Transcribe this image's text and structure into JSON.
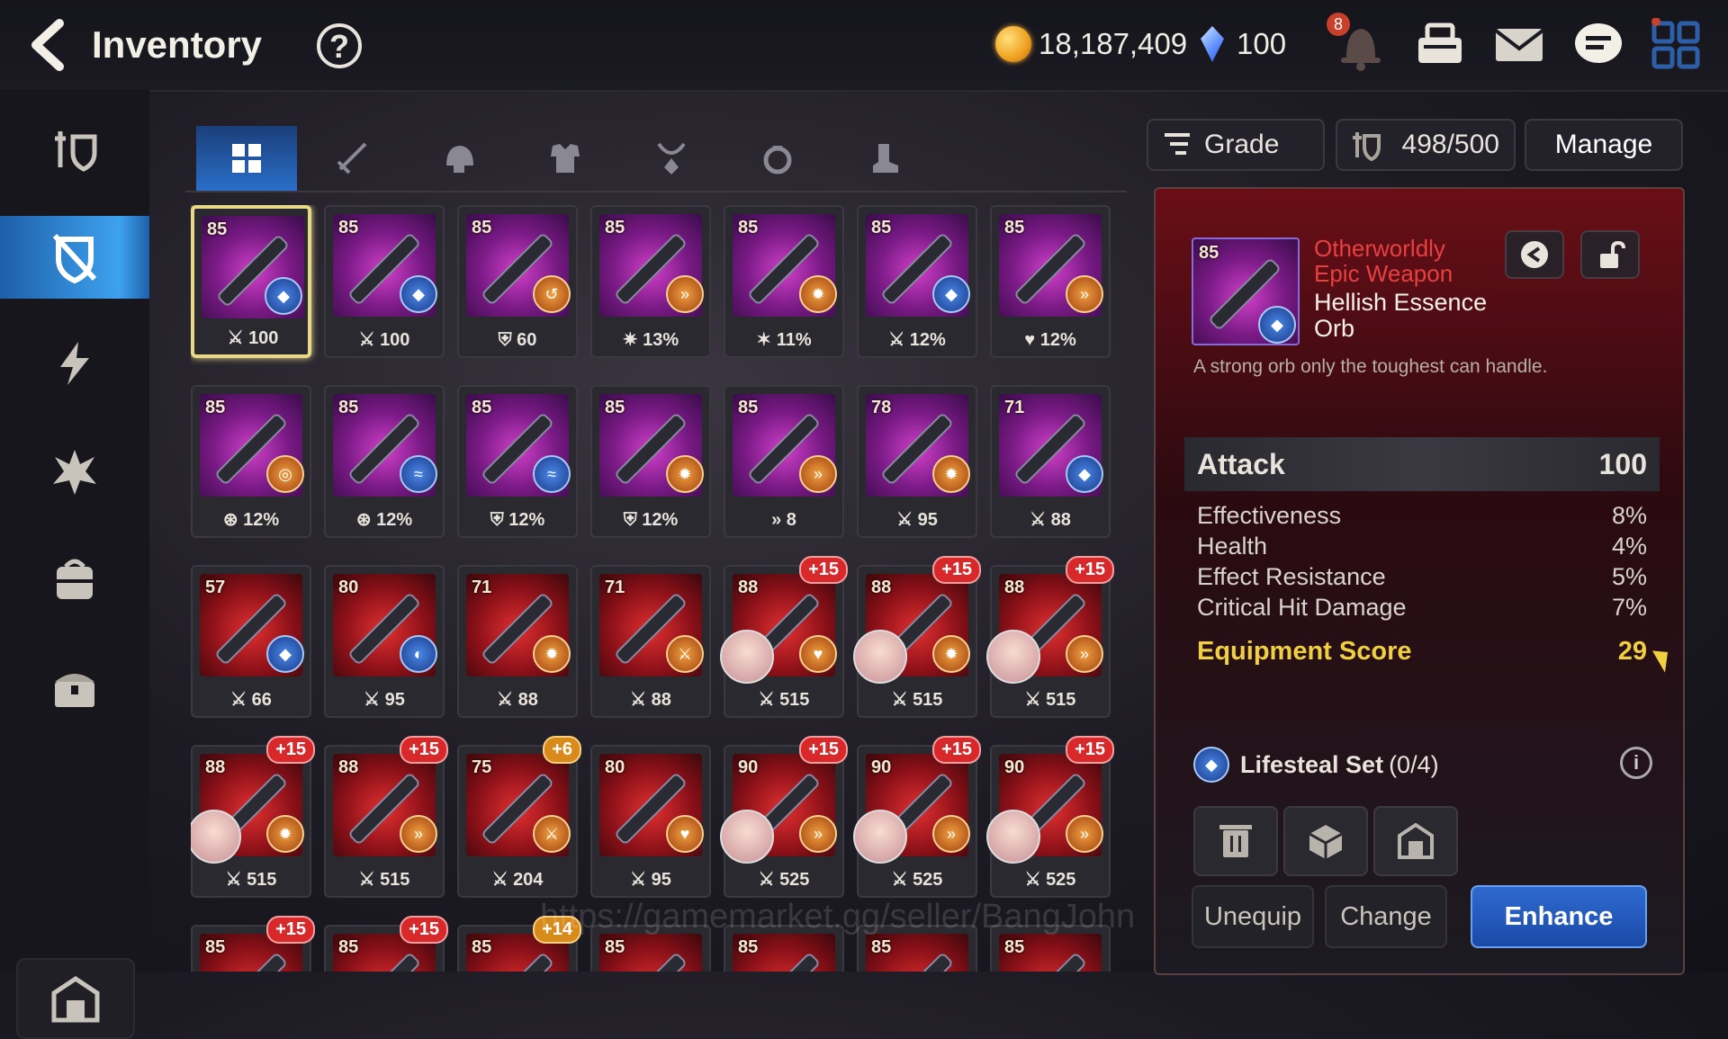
{
  "header": {
    "title": "Inventory",
    "help_label": "?",
    "gold": "18,187,409",
    "crystals": "100",
    "notification_count": "8"
  },
  "tabs": [
    "all",
    "weapon",
    "helmet",
    "armor",
    "necklace",
    "ring",
    "boots"
  ],
  "toolbar": {
    "grade_label": "Grade",
    "capacity": "498/500",
    "manage_label": "Manage"
  },
  "items": [
    {
      "level": "85",
      "stat": "100",
      "stat_icon": "attack",
      "set": "lifesteal",
      "plus": ""
    },
    {
      "level": "85",
      "stat": "100",
      "stat_icon": "attack",
      "set": "lifesteal",
      "plus": ""
    },
    {
      "level": "85",
      "stat": "60",
      "stat_icon": "defense",
      "set": "counter",
      "plus": ""
    },
    {
      "level": "85",
      "stat": "13%",
      "stat_icon": "effectiveness",
      "set": "speed",
      "plus": ""
    },
    {
      "level": "85",
      "stat": "11%",
      "stat_icon": "crit",
      "set": "immunity",
      "plus": ""
    },
    {
      "level": "85",
      "stat": "12%",
      "stat_icon": "attack",
      "set": "lifesteal",
      "plus": ""
    },
    {
      "level": "85",
      "stat": "12%",
      "stat_icon": "health",
      "set": "speed",
      "plus": ""
    },
    {
      "level": "85",
      "stat": "12%",
      "stat_icon": "resist",
      "set": "hit",
      "plus": ""
    },
    {
      "level": "85",
      "stat": "12%",
      "stat_icon": "resist",
      "set": "torrent",
      "plus": ""
    },
    {
      "level": "85",
      "stat": "12%",
      "stat_icon": "defense",
      "set": "torrent",
      "plus": ""
    },
    {
      "level": "85",
      "stat": "12%",
      "stat_icon": "defense",
      "set": "immunity",
      "plus": ""
    },
    {
      "level": "85",
      "stat": "8",
      "stat_icon": "speed",
      "set": "speed",
      "plus": ""
    },
    {
      "level": "78",
      "stat": "95",
      "stat_icon": "attack",
      "set": "immunity",
      "plus": ""
    },
    {
      "level": "71",
      "stat": "88",
      "stat_icon": "attack",
      "set": "lifesteal",
      "plus": ""
    },
    {
      "level": "57",
      "stat": "66",
      "stat_icon": "attack",
      "set": "lifesteal",
      "plus": ""
    },
    {
      "level": "80",
      "stat": "95",
      "stat_icon": "attack",
      "set": "protection",
      "plus": ""
    },
    {
      "level": "71",
      "stat": "88",
      "stat_icon": "attack",
      "set": "immunity",
      "plus": ""
    },
    {
      "level": "71",
      "stat": "88",
      "stat_icon": "attack",
      "set": "attack",
      "plus": ""
    },
    {
      "level": "88",
      "stat": "515",
      "stat_icon": "attack",
      "set": "health",
      "plus": "+15",
      "hero": true
    },
    {
      "level": "88",
      "stat": "515",
      "stat_icon": "attack",
      "set": "immunity",
      "plus": "+15",
      "hero": true
    },
    {
      "level": "88",
      "stat": "515",
      "stat_icon": "attack",
      "set": "speed",
      "plus": "+15",
      "hero": true
    },
    {
      "level": "88",
      "stat": "515",
      "stat_icon": "attack",
      "set": "immunity",
      "plus": "+15",
      "hero": true
    },
    {
      "level": "88",
      "stat": "515",
      "stat_icon": "attack",
      "set": "speed",
      "plus": "+15",
      "hero": false
    },
    {
      "level": "75",
      "stat": "204",
      "stat_icon": "attack",
      "set": "attack",
      "plus": "+6",
      "hero": false
    },
    {
      "level": "80",
      "stat": "95",
      "stat_icon": "attack",
      "set": "health",
      "plus": "",
      "hero": false
    },
    {
      "level": "90",
      "stat": "525",
      "stat_icon": "attack",
      "set": "speed",
      "plus": "+15",
      "hero": true
    },
    {
      "level": "90",
      "stat": "525",
      "stat_icon": "attack",
      "set": "speed",
      "plus": "+15",
      "hero": true
    },
    {
      "level": "90",
      "stat": "525",
      "stat_icon": "attack",
      "set": "speed",
      "plus": "+15",
      "hero": true
    },
    {
      "level": "85",
      "stat": "",
      "stat_icon": "",
      "set": "",
      "plus": "+15"
    },
    {
      "level": "85",
      "stat": "",
      "stat_icon": "",
      "set": "",
      "plus": "+15"
    },
    {
      "level": "85",
      "stat": "",
      "stat_icon": "",
      "set": "",
      "plus": "+14"
    },
    {
      "level": "85",
      "stat": "",
      "stat_icon": "",
      "set": "",
      "plus": ""
    },
    {
      "level": "85",
      "stat": "",
      "stat_icon": "",
      "set": "",
      "plus": ""
    },
    {
      "level": "85",
      "stat": "",
      "stat_icon": "",
      "set": "",
      "plus": ""
    },
    {
      "level": "85",
      "stat": "",
      "stat_icon": "",
      "set": "",
      "plus": ""
    }
  ],
  "detail": {
    "level": "85",
    "rarity_line1": "Otherworldly",
    "rarity_line2": "Epic Weapon",
    "name_line1": "Hellish Essence",
    "name_line2": "Orb",
    "description": "A strong orb only the toughest can handle.",
    "main_stat_name": "Attack",
    "main_stat_value": "100",
    "substats": [
      {
        "name": "Effectiveness",
        "value": "8%"
      },
      {
        "name": "Health",
        "value": "4%"
      },
      {
        "name": "Effect Resistance",
        "value": "5%"
      },
      {
        "name": "Critical Hit Damage",
        "value": "7%"
      }
    ],
    "score_label": "Equipment Score",
    "score_value": "29",
    "set_name": "Lifesteal Set",
    "set_count": "(0/4)",
    "unequip_label": "Unequip",
    "change_label": "Change",
    "enhance_label": "Enhance"
  },
  "watermark": "https://gamemarket.gg/seller/BangJohn",
  "colors": {
    "accent_blue": "#3ea2f0",
    "rarity_red": "#e84040",
    "score_gold": "#f0d040",
    "badge_red": "#d8282a"
  }
}
